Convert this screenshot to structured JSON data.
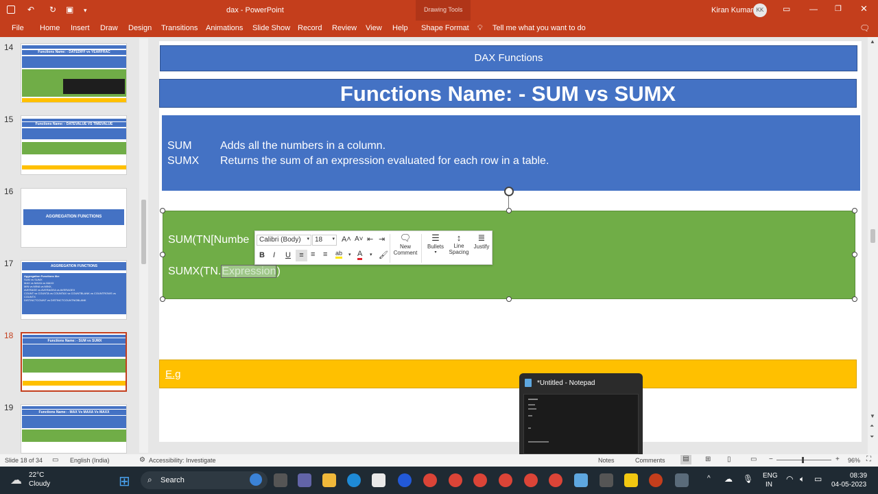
{
  "window": {
    "doc_title": "dax",
    "app_name": "PowerPoint",
    "user_name": "Kiran Kumar",
    "user_initials": "KK",
    "separator": " - "
  },
  "ribbon": {
    "context_group": "Drawing Tools",
    "tabs": [
      "File",
      "Home",
      "Insert",
      "Draw",
      "Design",
      "Transitions",
      "Animations",
      "Slide Show",
      "Record",
      "Review",
      "View",
      "Help",
      "Shape Format"
    ],
    "tell_me": "Tell me what you want to do"
  },
  "thumbnails": [
    {
      "num": "14",
      "title": "Functions Name: - DATEDIFF vs YEARFRAC"
    },
    {
      "num": "15",
      "title": "Functions Name: - DATEVALUE VS TIMEVALUE"
    },
    {
      "num": "16",
      "title": "AGGREGATION FUNCTIONS"
    },
    {
      "num": "17",
      "title": "AGGREGATION FUNCTIONS",
      "lines": [
        "Aggregation Functions  like",
        "SUM vs SUMX",
        "MAX vs MAXA vs MAXX",
        "MIN vs MINA vs MINX,",
        "AVERAGE vs AVERAGEA vs AVERAGEX",
        "COUNT vs COUNTA vs COUNTAX vs COUNTBLANK vs COUNTROWS vs COUNTX",
        "DISTINCTCOUNT vs DISTINCTCOUNTNOBLANK"
      ]
    },
    {
      "num": "18",
      "title": "Functions Name: - SUM vs SUMX"
    },
    {
      "num": "19",
      "title": "Functions Name: - MAX Vs MAXA Vs MAXX"
    }
  ],
  "slide": {
    "header": "DAX Functions",
    "title": "Functions Name: - SUM vs SUMX",
    "rows": [
      {
        "name": "SUM",
        "desc": "Adds all the numbers in a column."
      },
      {
        "name": "SUMX",
        "desc": "Returns the sum of an expression evaluated for each row in a table."
      }
    ],
    "syntax1": "SUM(TN[Numbe",
    "syntax2_prefix": "SUMX(TN.",
    "syntax2_highlight": "Expression",
    "syntax2_suffix": ")",
    "eg": "E.g"
  },
  "mini_toolbar": {
    "font": "Calibri (Body)",
    "size": "18",
    "new_comment": [
      "New",
      "Comment"
    ],
    "bullets": "Bullets",
    "line_spacing": [
      "Line",
      "Spacing"
    ],
    "justify": "Justify"
  },
  "notepad": {
    "title": "*Untitled - Notepad"
  },
  "status": {
    "slide_of": "Slide 18 of 34",
    "language": "English (India)",
    "accessibility": "Accessibility: Investigate",
    "notes": "Notes",
    "comments": "Comments",
    "zoom": "96%"
  },
  "taskbar": {
    "temp": "22°C",
    "weather": "Cloudy",
    "search": "Search",
    "lang1": "ENG",
    "lang2": "IN",
    "time": "08:39",
    "date": "04-05-2023"
  },
  "colors": {
    "accent": "#c43e1c",
    "slide_blue": "#4472c4",
    "slide_green": "#70ad47",
    "slide_yellow": "#ffc000"
  }
}
